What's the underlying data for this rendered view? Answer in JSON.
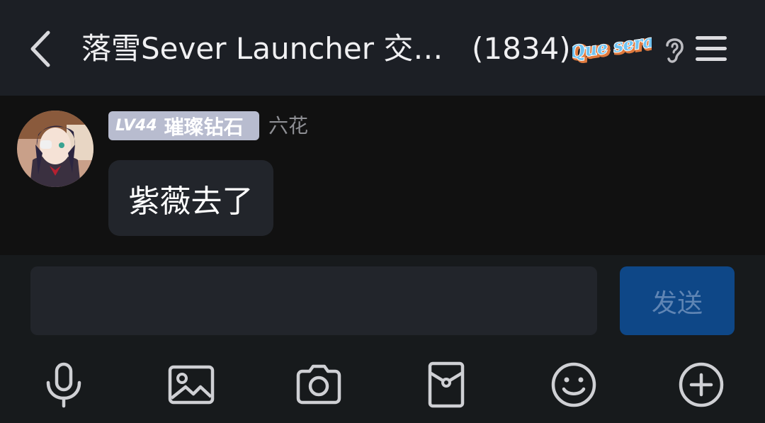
{
  "header": {
    "title": "落雪Sever Launcher 交…",
    "member_count": "(1834)",
    "badge_text": "Que sera"
  },
  "message": {
    "level": "LV44",
    "rank": "璀璨钻石",
    "sender": "六花",
    "text": "紫薇去了"
  },
  "composer": {
    "input_value": "",
    "send_label": "发送"
  },
  "toolbar": {
    "icons": [
      "microphone-icon",
      "image-icon",
      "camera-icon",
      "red-packet-icon",
      "emoji-icon",
      "plus-icon"
    ]
  },
  "colors": {
    "header_bg": "#1c1f25",
    "chat_bg": "#111111",
    "bubble_bg": "#22252b",
    "send_button": "#0e4787",
    "level_tag": "#b8bccf"
  }
}
